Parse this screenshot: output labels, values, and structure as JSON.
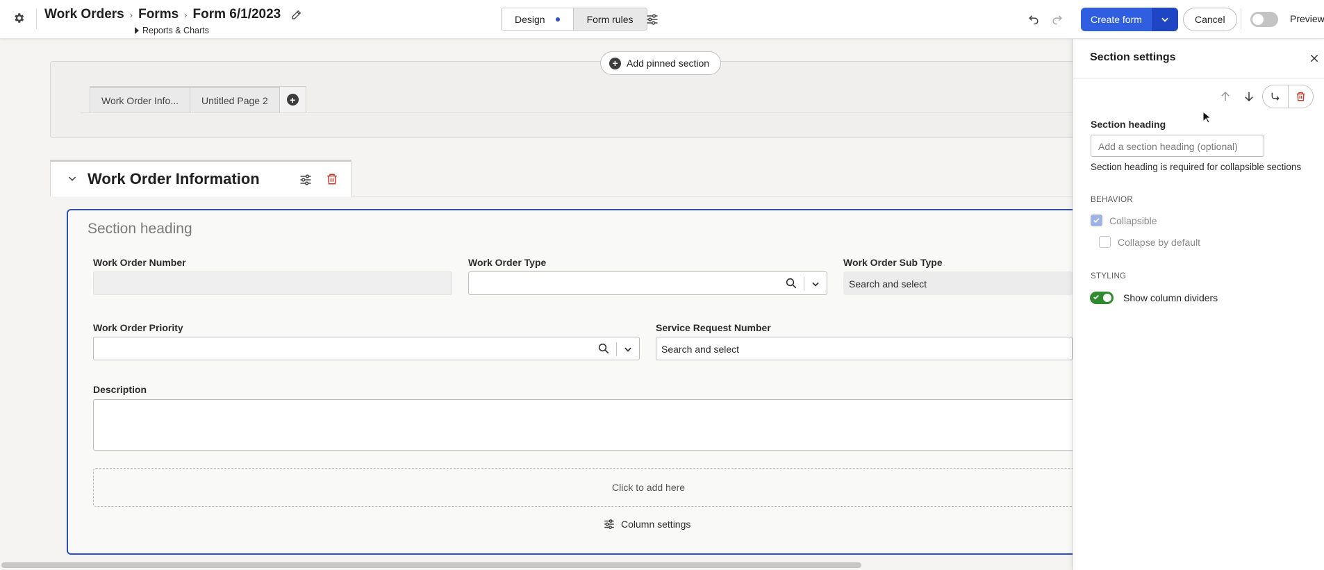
{
  "header": {
    "breadcrumbs": [
      "Work Orders",
      "Forms",
      "Form 6/1/2023"
    ],
    "sub_link": "Reports & Charts",
    "mode_tabs": [
      "Design",
      "Form rules"
    ],
    "create_label": "Create form",
    "cancel_label": "Cancel",
    "preview_label": "Preview",
    "preview_enabled": false
  },
  "canvas": {
    "add_pinned_label": "Add pinned section",
    "page_tabs": [
      "Work Order Info...",
      "Untitled Page 2"
    ],
    "section_title": "Work Order Information",
    "section_heading_placeholder": "Section heading",
    "fields": {
      "wo_number": {
        "label": "Work Order Number",
        "value": ""
      },
      "wo_type": {
        "label": "Work Order Type",
        "value": ""
      },
      "wo_sub_type": {
        "label": "Work Order Sub Type",
        "placeholder": "Search and select"
      },
      "wo_priority": {
        "label": "Work Order Priority",
        "value": ""
      },
      "service_request": {
        "label": "Service Request Number",
        "placeholder": "Search and select"
      },
      "description": {
        "label": "Description",
        "value": ""
      }
    },
    "dropzone_text": "Click to add here",
    "column_settings_label": "Column settings"
  },
  "panel": {
    "title": "Section settings",
    "heading_label": "Section heading",
    "heading_placeholder": "Add a section heading (optional)",
    "heading_help": "Section heading is required for collapsible sections",
    "behavior_caption": "BEHAVIOR",
    "collapsible_label": "Collapsible",
    "collapsible_checked": true,
    "collapse_default_label": "Collapse by default",
    "collapse_default_checked": false,
    "styling_caption": "STYLING",
    "dividers_label": "Show column dividers",
    "dividers_on": true
  },
  "colors": {
    "accent": "#2f5fe0",
    "accent_dark": "#1e45c3",
    "selection_border": "#2b4ec9",
    "trash": "#c0392b",
    "toggle_on": "#2e8b2e"
  }
}
